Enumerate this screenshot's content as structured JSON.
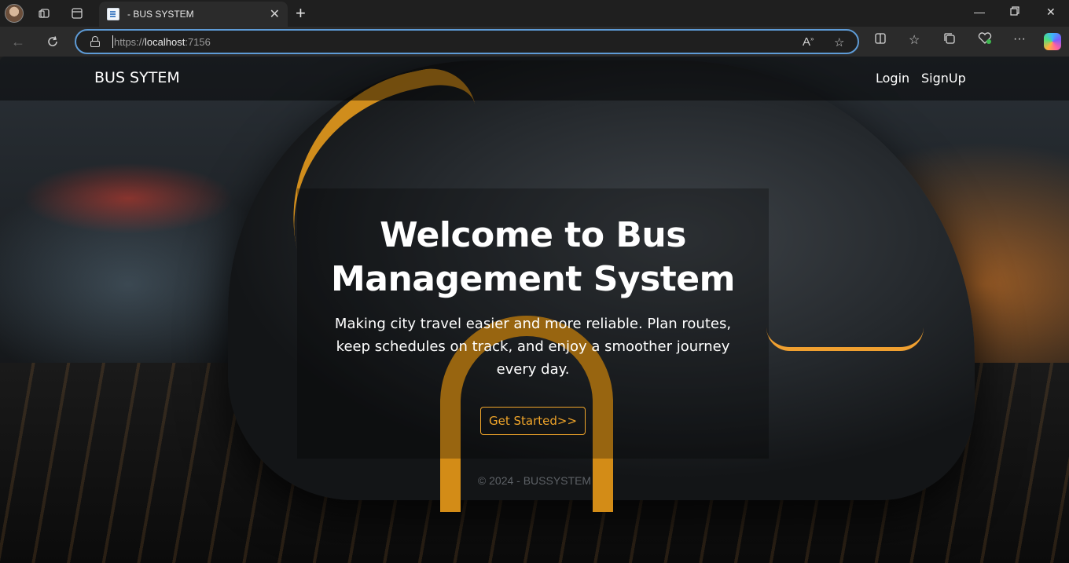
{
  "browser": {
    "tab_title": "- BUS SYSTEM",
    "url_scheme": "https://",
    "url_host": "localhost",
    "url_port": ":7156",
    "icons": [
      "profile-avatar",
      "workspaces-icon",
      "tab-actions-icon",
      "close-icon",
      "new-tab-icon",
      "minimize-icon",
      "restore-icon",
      "window-close-icon",
      "back-icon",
      "refresh-icon",
      "lock-icon",
      "read-aloud-icon",
      "favorite-icon",
      "split-screen-icon",
      "favorites-icon",
      "collections-icon",
      "browser-essentials-icon",
      "more-icon",
      "copilot-icon"
    ]
  },
  "page": {
    "brand": "BUS SYTEM",
    "nav": {
      "login": "Login",
      "signup": "SignUp"
    },
    "hero": {
      "title": "Welcome to Bus Management System",
      "subtitle": "Making city travel easier and more reliable. Plan routes, keep schedules on track, and enjoy a smoother journey every day.",
      "cta": "Get Started>>"
    },
    "footer": "© 2024 - BUSSYSTEM",
    "colors": {
      "accent": "#f0a52a",
      "text": "#ffffff",
      "footer": "#5d6166"
    }
  }
}
